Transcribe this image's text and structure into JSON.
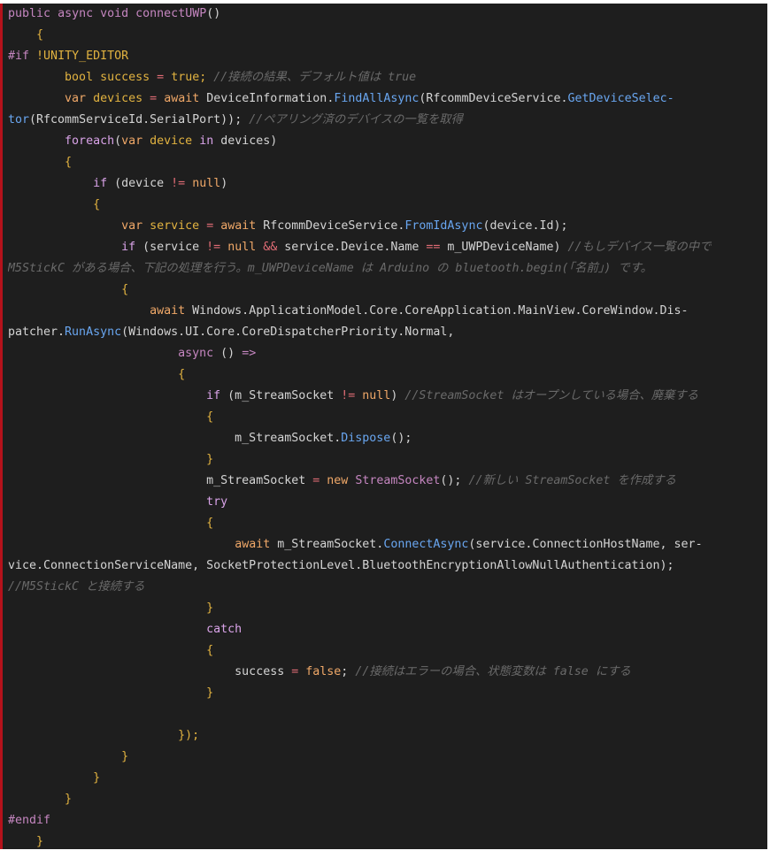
{
  "theme": {
    "background": "#1e1e1e",
    "accent_border": "#b5121b",
    "default_text": "#d4d4d4",
    "keyword": "#c586c0",
    "storage": "#e2b340",
    "control": "#d9a3e8",
    "literal": "#f0a868",
    "function": "#69a6f0",
    "comment": "#6a6a6a",
    "operator": "#e06c75"
  },
  "code": [
    {
      "tokens": [
        {
          "t": "public",
          "c": "keyword"
        },
        {
          "t": " "
        },
        {
          "t": "async",
          "c": "keyword"
        },
        {
          "t": " "
        },
        {
          "t": "void",
          "c": "keyword"
        },
        {
          "t": " "
        },
        {
          "t": "connectUWP",
          "c": "keyword"
        },
        {
          "t": "()"
        }
      ]
    },
    {
      "tokens": [
        {
          "t": "    "
        },
        {
          "t": "{",
          "c": "storage"
        }
      ]
    },
    {
      "tokens": [
        {
          "t": "#if",
          "c": "keyword"
        },
        {
          "t": " "
        },
        {
          "t": "!UNITY_EDITOR",
          "c": "storage"
        }
      ]
    },
    {
      "tokens": [
        {
          "t": "        "
        },
        {
          "t": "bool",
          "c": "storage"
        },
        {
          "t": " "
        },
        {
          "t": "success",
          "c": "storage"
        },
        {
          "t": " "
        },
        {
          "t": "=",
          "c": "operator"
        },
        {
          "t": " "
        },
        {
          "t": "true",
          "c": "storage"
        },
        {
          "t": ";",
          "c": "storage"
        },
        {
          "t": " "
        },
        {
          "t": "//接続の結果、デフォルト値は true",
          "c": "comment"
        }
      ]
    },
    {
      "tokens": [
        {
          "t": "        "
        },
        {
          "t": "var",
          "c": "literal"
        },
        {
          "t": " "
        },
        {
          "t": "devices",
          "c": "storage"
        },
        {
          "t": " "
        },
        {
          "t": "=",
          "c": "operator"
        },
        {
          "t": " "
        },
        {
          "t": "await",
          "c": "literal"
        },
        {
          "t": " DeviceInformation."
        },
        {
          "t": "FindAllAsync",
          "c": "function"
        },
        {
          "t": "(RfcommDeviceService."
        },
        {
          "t": "GetDeviceSelec-",
          "c": "function"
        }
      ]
    },
    {
      "tokens": [
        {
          "t": "tor",
          "c": "function"
        },
        {
          "t": "(RfcommServiceId.SerialPort));"
        },
        {
          "t": " "
        },
        {
          "t": "//ペアリング済のデバイスの一覧を取得",
          "c": "comment"
        }
      ]
    },
    {
      "tokens": [
        {
          "t": "        "
        },
        {
          "t": "foreach",
          "c": "control"
        },
        {
          "t": "("
        },
        {
          "t": "var",
          "c": "literal"
        },
        {
          "t": " "
        },
        {
          "t": "device",
          "c": "storage"
        },
        {
          "t": " "
        },
        {
          "t": "in",
          "c": "control"
        },
        {
          "t": " devices)"
        }
      ]
    },
    {
      "tokens": [
        {
          "t": "        "
        },
        {
          "t": "{",
          "c": "storage"
        }
      ]
    },
    {
      "tokens": [
        {
          "t": "            "
        },
        {
          "t": "if",
          "c": "control"
        },
        {
          "t": " (device "
        },
        {
          "t": "!=",
          "c": "operator"
        },
        {
          "t": " "
        },
        {
          "t": "null",
          "c": "literal"
        },
        {
          "t": ")"
        }
      ]
    },
    {
      "tokens": [
        {
          "t": "            "
        },
        {
          "t": "{",
          "c": "storage"
        }
      ]
    },
    {
      "tokens": [
        {
          "t": "                "
        },
        {
          "t": "var",
          "c": "literal"
        },
        {
          "t": " "
        },
        {
          "t": "service",
          "c": "storage"
        },
        {
          "t": " "
        },
        {
          "t": "=",
          "c": "operator"
        },
        {
          "t": " "
        },
        {
          "t": "await",
          "c": "literal"
        },
        {
          "t": " RfcommDeviceService."
        },
        {
          "t": "FromIdAsync",
          "c": "function"
        },
        {
          "t": "(device.Id);"
        }
      ]
    },
    {
      "tokens": [
        {
          "t": "                "
        },
        {
          "t": "if",
          "c": "control"
        },
        {
          "t": " (service "
        },
        {
          "t": "!=",
          "c": "operator"
        },
        {
          "t": " "
        },
        {
          "t": "null",
          "c": "literal"
        },
        {
          "t": " "
        },
        {
          "t": "&&",
          "c": "operator"
        },
        {
          "t": " service.Device.Name "
        },
        {
          "t": "==",
          "c": "operator"
        },
        {
          "t": " m_UWPDeviceName)"
        },
        {
          "t": " "
        },
        {
          "t": "//もしデバイス一覧の中で",
          "c": "comment"
        }
      ]
    },
    {
      "tokens": [
        {
          "t": "M5StickC がある場合、下記の処理を行う。m_UWPDeviceName は Arduino の bluetooth.begin(「名前」) です。",
          "c": "comment"
        }
      ]
    },
    {
      "tokens": [
        {
          "t": "                "
        },
        {
          "t": "{",
          "c": "storage"
        }
      ]
    },
    {
      "tokens": [
        {
          "t": "                    "
        },
        {
          "t": "await",
          "c": "literal"
        },
        {
          "t": " Windows.ApplicationModel.Core.CoreApplication.MainView.CoreWindow.Dis-"
        }
      ]
    },
    {
      "tokens": [
        {
          "t": "patcher."
        },
        {
          "t": "RunAsync",
          "c": "function"
        },
        {
          "t": "(Windows.UI.Core.CoreDispatcherPriority.Normal,"
        }
      ]
    },
    {
      "tokens": [
        {
          "t": "                        "
        },
        {
          "t": "async",
          "c": "keyword"
        },
        {
          "t": " () "
        },
        {
          "t": "=>",
          "c": "keyword"
        }
      ]
    },
    {
      "tokens": [
        {
          "t": "                        "
        },
        {
          "t": "{",
          "c": "storage"
        }
      ]
    },
    {
      "tokens": [
        {
          "t": "                            "
        },
        {
          "t": "if",
          "c": "control"
        },
        {
          "t": " (m_StreamSocket "
        },
        {
          "t": "!=",
          "c": "operator"
        },
        {
          "t": " "
        },
        {
          "t": "null",
          "c": "literal"
        },
        {
          "t": ")"
        },
        {
          "t": " "
        },
        {
          "t": "//StreamSocket はオープンしている場合、廃棄する",
          "c": "comment"
        }
      ]
    },
    {
      "tokens": [
        {
          "t": "                            "
        },
        {
          "t": "{",
          "c": "storage"
        }
      ]
    },
    {
      "tokens": [
        {
          "t": "                                m_StreamSocket."
        },
        {
          "t": "Dispose",
          "c": "function"
        },
        {
          "t": "();"
        }
      ]
    },
    {
      "tokens": [
        {
          "t": "                            "
        },
        {
          "t": "}",
          "c": "storage"
        }
      ]
    },
    {
      "tokens": [
        {
          "t": "                            m_StreamSocket "
        },
        {
          "t": "=",
          "c": "operator"
        },
        {
          "t": " "
        },
        {
          "t": "new",
          "c": "literal"
        },
        {
          "t": " "
        },
        {
          "t": "StreamSocket",
          "c": "keyword"
        },
        {
          "t": "();"
        },
        {
          "t": " "
        },
        {
          "t": "//新しい StreamSocket を作成する",
          "c": "comment"
        }
      ]
    },
    {
      "tokens": [
        {
          "t": "                            "
        },
        {
          "t": "try",
          "c": "control"
        }
      ]
    },
    {
      "tokens": [
        {
          "t": "                            "
        },
        {
          "t": "{",
          "c": "storage"
        }
      ]
    },
    {
      "tokens": [
        {
          "t": "                                "
        },
        {
          "t": "await",
          "c": "literal"
        },
        {
          "t": " m_StreamSocket."
        },
        {
          "t": "ConnectAsync",
          "c": "function"
        },
        {
          "t": "(service.ConnectionHostName, ser-"
        }
      ]
    },
    {
      "tokens": [
        {
          "t": "vice.ConnectionServiceName, SocketProtectionLevel.BluetoothEncryptionAllowNullAuthentication);"
        }
      ]
    },
    {
      "tokens": [
        {
          "t": "//M5StickC と接続する",
          "c": "comment"
        }
      ]
    },
    {
      "tokens": [
        {
          "t": "                            "
        },
        {
          "t": "}",
          "c": "storage"
        }
      ]
    },
    {
      "tokens": [
        {
          "t": "                            "
        },
        {
          "t": "catch",
          "c": "control"
        }
      ]
    },
    {
      "tokens": [
        {
          "t": "                            "
        },
        {
          "t": "{",
          "c": "storage"
        }
      ]
    },
    {
      "tokens": [
        {
          "t": "                                success "
        },
        {
          "t": "=",
          "c": "operator"
        },
        {
          "t": " "
        },
        {
          "t": "false",
          "c": "literal"
        },
        {
          "t": ";"
        },
        {
          "t": " "
        },
        {
          "t": "//接続はエラーの場合、状態変数は false にする",
          "c": "comment"
        }
      ]
    },
    {
      "tokens": [
        {
          "t": "                            "
        },
        {
          "t": "}",
          "c": "storage"
        }
      ]
    },
    {
      "tokens": [
        {
          "t": ""
        }
      ]
    },
    {
      "tokens": [
        {
          "t": "                        "
        },
        {
          "t": "});",
          "c": "storage"
        }
      ]
    },
    {
      "tokens": [
        {
          "t": "                "
        },
        {
          "t": "}",
          "c": "storage"
        }
      ]
    },
    {
      "tokens": [
        {
          "t": "            "
        },
        {
          "t": "}",
          "c": "storage"
        }
      ]
    },
    {
      "tokens": [
        {
          "t": "        "
        },
        {
          "t": "}",
          "c": "storage"
        }
      ]
    },
    {
      "tokens": [
        {
          "t": "#endif",
          "c": "keyword"
        }
      ]
    },
    {
      "tokens": [
        {
          "t": "    "
        },
        {
          "t": "}",
          "c": "storage"
        }
      ]
    }
  ]
}
